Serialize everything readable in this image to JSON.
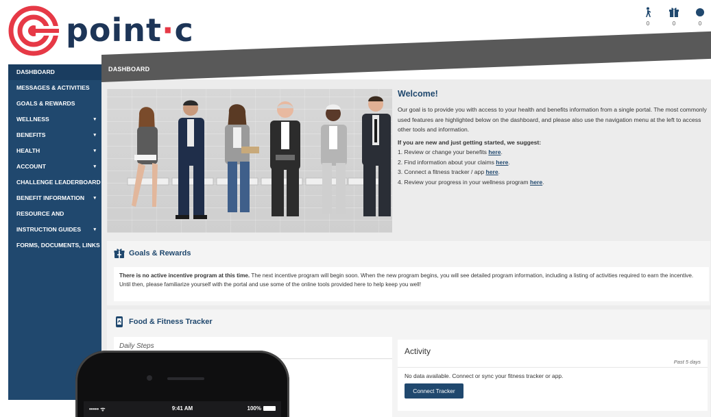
{
  "brand": {
    "name_left": "point",
    "separator": "·",
    "name_right": "c"
  },
  "top_icons": [
    {
      "icon": "walker-icon",
      "count": "0"
    },
    {
      "icon": "gift-icon",
      "count": "0"
    },
    {
      "icon": "notification-dot-icon",
      "count": "0"
    }
  ],
  "topbar": {
    "title": "DASHBOARD"
  },
  "sidebar": {
    "items": [
      {
        "label": "DASHBOARD",
        "caret": ""
      },
      {
        "label": "MESSAGES & ACTIVITIES",
        "caret": ""
      },
      {
        "label": "GOALS & REWARDS",
        "caret": ""
      },
      {
        "label": "WELLNESS",
        "caret": "▾"
      },
      {
        "label": "BENEFITS",
        "caret": "▾"
      },
      {
        "label": "HEALTH",
        "caret": "▾"
      },
      {
        "label": "ACCOUNT",
        "caret": "▾"
      },
      {
        "label": "CHALLENGE LEADERBOARD",
        "caret": ""
      },
      {
        "label": "BENEFIT INFORMATION",
        "caret": "▾"
      },
      {
        "label": "RESOURCE AND",
        "caret": ""
      },
      {
        "label": "INSTRUCTION GUIDES",
        "caret": "▾"
      },
      {
        "label": "FORMS, DOCUMENTS, LINKS",
        "caret": ""
      }
    ]
  },
  "welcome": {
    "title": "Welcome!",
    "intro": "Our goal is to provide you with access to your health and benefits information from a single portal. The most commonly used features are highlighted below on the dashboard, and please also use the navigation menu at the left to access other tools and information.",
    "lead": "If you are new and just getting started, we suggest:",
    "steps": [
      {
        "text": "1. Review or change your benefits ",
        "link": "here"
      },
      {
        "text": "2. Find information about your claims ",
        "link": "here"
      },
      {
        "text": "3. Connect a fitness tracker / app ",
        "link": "here"
      },
      {
        "text": "4. Review your progress in your wellness program ",
        "link": "here"
      }
    ],
    "period": "."
  },
  "goals": {
    "title": "Goals & Rewards",
    "bold": "There is no active incentive program at this time.",
    "text": " The next incentive program will begin soon. When the new program begins, you will see detailed program information, including a listing of activities required to earn the incentive. Until then, please familiarize yourself with the portal and use some of the online tools provided here to help keep you well!"
  },
  "food": {
    "title": "Food & Fitness Tracker",
    "daily_steps": "Daily Steps",
    "activity_title": "Activity",
    "activity_period": "Past 5 days",
    "no_data": "No data available. Connect or sync your fitness tracker or app.",
    "connect_button": "Connect Tracker"
  },
  "phone": {
    "signal": "••••• ᯤ",
    "time": "9:41 AM",
    "battery": "100%"
  },
  "colors": {
    "navy": "#20486e",
    "red": "#e63946",
    "topbar": "#595959"
  }
}
